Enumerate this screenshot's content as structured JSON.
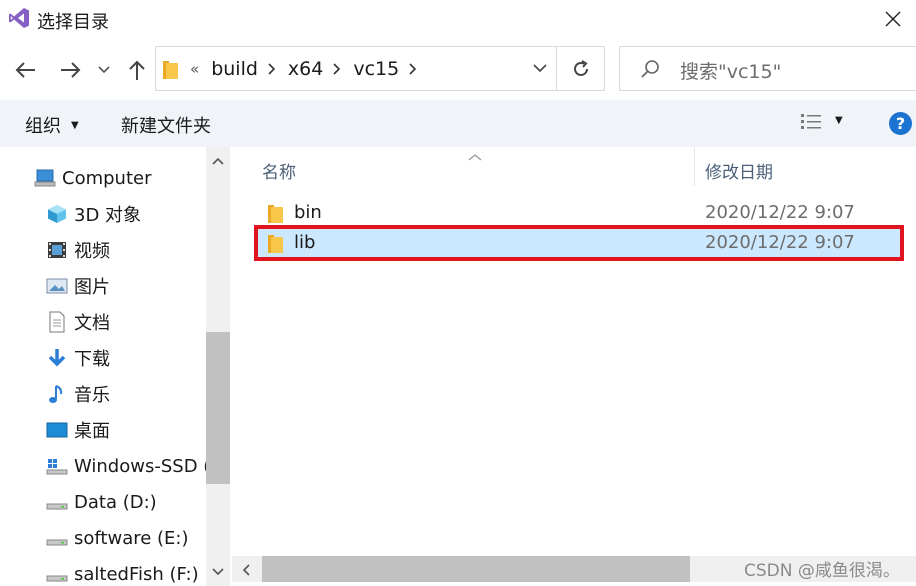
{
  "window": {
    "title": "选择目录"
  },
  "address": {
    "overflow": "«",
    "crumbs": [
      "build",
      "x64",
      "vc15"
    ]
  },
  "search": {
    "placeholder": "搜索\"vc15\""
  },
  "toolbar": {
    "organize": "组织",
    "new_folder": "新建文件夹"
  },
  "nav": {
    "items": [
      {
        "label": "Computer",
        "icon": "computer-icon"
      },
      {
        "label": "3D 对象",
        "icon": "3d-objects-icon"
      },
      {
        "label": "视频",
        "icon": "video-icon"
      },
      {
        "label": "图片",
        "icon": "pictures-icon"
      },
      {
        "label": "文档",
        "icon": "documents-icon"
      },
      {
        "label": "下载",
        "icon": "download-icon"
      },
      {
        "label": "音乐",
        "icon": "music-icon"
      },
      {
        "label": "桌面",
        "icon": "desktop-icon"
      },
      {
        "label": "Windows-SSD (",
        "icon": "drive-icon"
      },
      {
        "label": "Data (D:)",
        "icon": "drive-icon"
      },
      {
        "label": "software (E:)",
        "icon": "drive-icon"
      },
      {
        "label": "saltedFish (F:)",
        "icon": "drive-icon"
      }
    ]
  },
  "columns": {
    "name": "名称",
    "date": "修改日期"
  },
  "files": [
    {
      "name": "bin",
      "date": "2020/12/22 9:07",
      "selected": false
    },
    {
      "name": "lib",
      "date": "2020/12/22 9:07",
      "selected": true
    }
  ],
  "watermark": "CSDN @咸鱼很渴。",
  "colors": {
    "selection": "#cce8ff",
    "highlight_border": "#e0141e",
    "folder": "#f8c74a",
    "help": "#1a73d1"
  }
}
